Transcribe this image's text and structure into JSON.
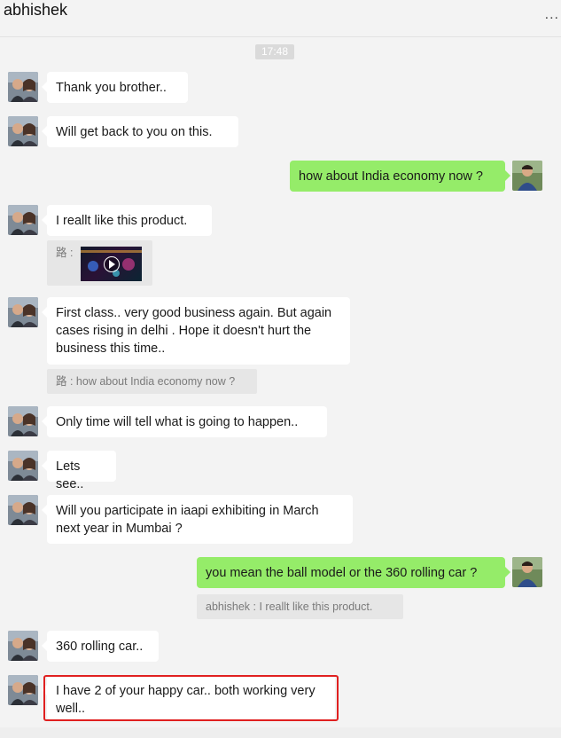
{
  "header": {
    "title": "abhishek",
    "more_label": "..."
  },
  "timestamp": "17:48",
  "messages": [
    {
      "text": "Thank you brother.."
    },
    {
      "text": "Will get back to you on this."
    },
    {
      "text": "how about India economy now ?"
    },
    {
      "text": "I reallt like this product."
    },
    {
      "quote_prefix": "路 :"
    },
    {
      "text": "First class.. very good business again.  But again cases rising in delhi . Hope it doesn't hurt the business this time.."
    },
    {
      "quote": "路 : how about India economy now ?"
    },
    {
      "text": "Only time will tell what is going to happen.."
    },
    {
      "text": "Lets see.."
    },
    {
      "text": "Will you participate in iaapi exhibiting in March next year in Mumbai ?"
    },
    {
      "text": "you mean the ball model or the 360 rolling car ?"
    },
    {
      "quote": "abhishek : I reallt like this product."
    },
    {
      "text": "360 rolling car.."
    },
    {
      "text": "I have 2 of your happy car.. both working very well.."
    }
  ],
  "colors": {
    "background": "#f3f3f3",
    "incoming_bubble": "#ffffff",
    "outgoing_bubble": "#95ec69",
    "quote_bg": "#e6e6e6",
    "highlight_border": "#e02020"
  },
  "icons": {
    "more": "more-dots-icon",
    "play": "play-icon"
  }
}
